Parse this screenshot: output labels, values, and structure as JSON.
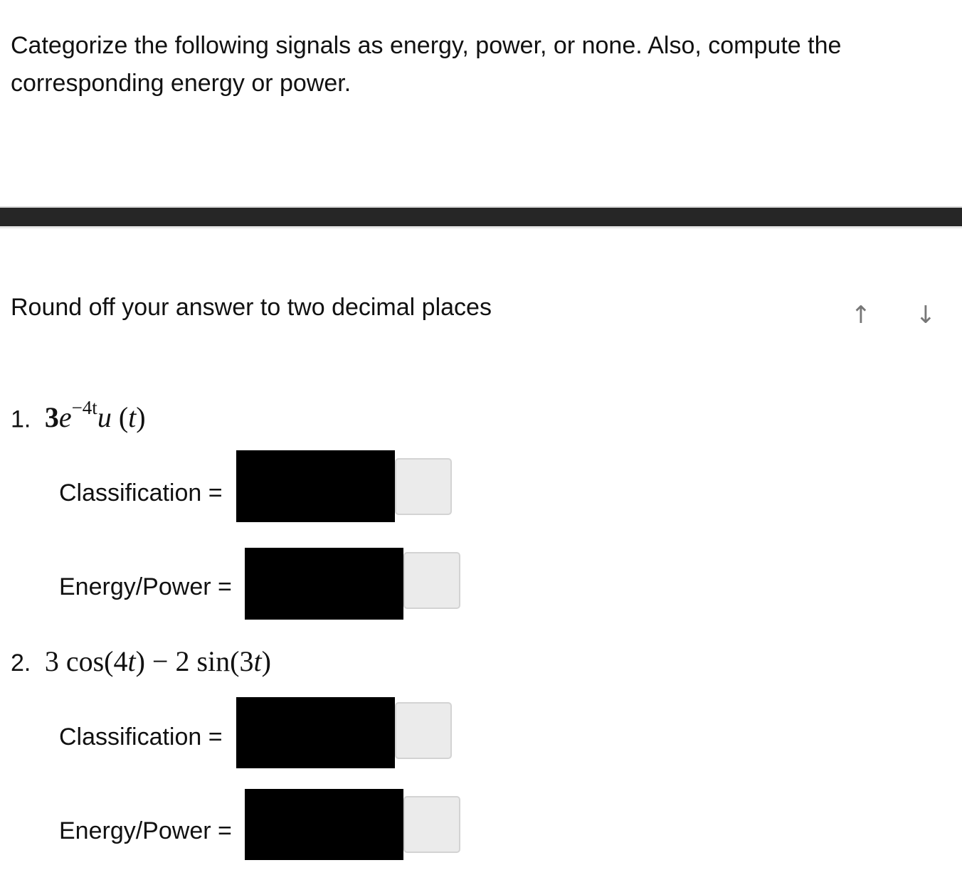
{
  "intro": {
    "line1": "Categorize the following signals as energy, power, or none. Also, compute the",
    "line2": "corresponding energy or power."
  },
  "instruction": "Round off your answer to two decimal places",
  "nav": {
    "up_icon": "arrow-up-icon",
    "down_icon": "arrow-down-icon",
    "up_glyph": "↑",
    "down_glyph": "↓"
  },
  "problems": [
    {
      "number": "1.",
      "expression": {
        "coef": "3",
        "base": "e",
        "exponent": "−4t",
        "func": "u",
        "arg_open": " (",
        "arg": "t",
        "arg_close": ")"
      },
      "fields": [
        {
          "label": "Classification =",
          "value": ""
        },
        {
          "label": "Energy/Power =",
          "value": ""
        }
      ]
    },
    {
      "number": "2.",
      "expression": {
        "part1": "3 cos(4",
        "var1": "t",
        "part2": ") − 2 sin(3",
        "var2": "t",
        "part3": ")"
      },
      "fields": [
        {
          "label": "Classification =",
          "value": ""
        },
        {
          "label": "Energy/Power =",
          "value": ""
        }
      ]
    }
  ]
}
